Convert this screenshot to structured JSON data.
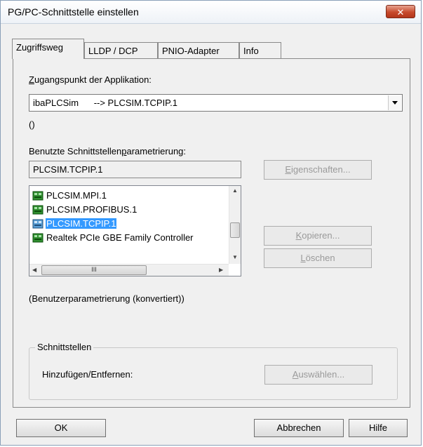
{
  "window": {
    "title": "PG/PC-Schnittstelle einstellen",
    "close_label": "✕"
  },
  "tabs": [
    {
      "label": "Zugriffsweg",
      "active": true
    },
    {
      "label": "LLDP / DCP",
      "active": false
    },
    {
      "label": "PNIO-Adapter",
      "active": false
    },
    {
      "label": "Info",
      "active": false
    }
  ],
  "access_point": {
    "label_first": "Z",
    "label_rest": "ugangspunkt der Applikation:",
    "combo_value": "ibaPLCSim      --> PLCSIM.TCPIP.1",
    "sub_value": "()"
  },
  "interface_param": {
    "label_prefix": "Benutzte Schnittstellen",
    "label_underline": "p",
    "label_suffix": "arametrierung:",
    "current_value": "PLCSIM.TCPIP.1",
    "list": [
      {
        "text": "PLCSIM.MPI.1",
        "icon": "network-adapter-icon",
        "selected": false
      },
      {
        "text": "PLCSIM.PROFIBUS.1",
        "icon": "network-adapter-icon",
        "selected": false
      },
      {
        "text": "PLCSIM.TCPIP.1",
        "icon": "network-adapter-icon",
        "selected": true
      },
      {
        "text": "Realtek PCIe GBE Family Controller",
        "icon": "network-adapter-icon",
        "selected": false
      }
    ],
    "hscroll_grip": "III"
  },
  "buttons": {
    "properties_first": "E",
    "properties_rest": "igenschaften...",
    "copy_first": "K",
    "copy_rest": "opieren...",
    "delete_first": "L",
    "delete_rest": "öschen",
    "select_first": "A",
    "select_rest": "uswählen..."
  },
  "status_text": "(Benutzerparametrierung (konvertiert))",
  "interfaces_group": {
    "title": "Schnittstellen",
    "add_remove_label": "Hinzufügen/Entfernen:"
  },
  "footer": {
    "ok": "OK",
    "cancel": "Abbrechen",
    "help": "Hilfe"
  }
}
